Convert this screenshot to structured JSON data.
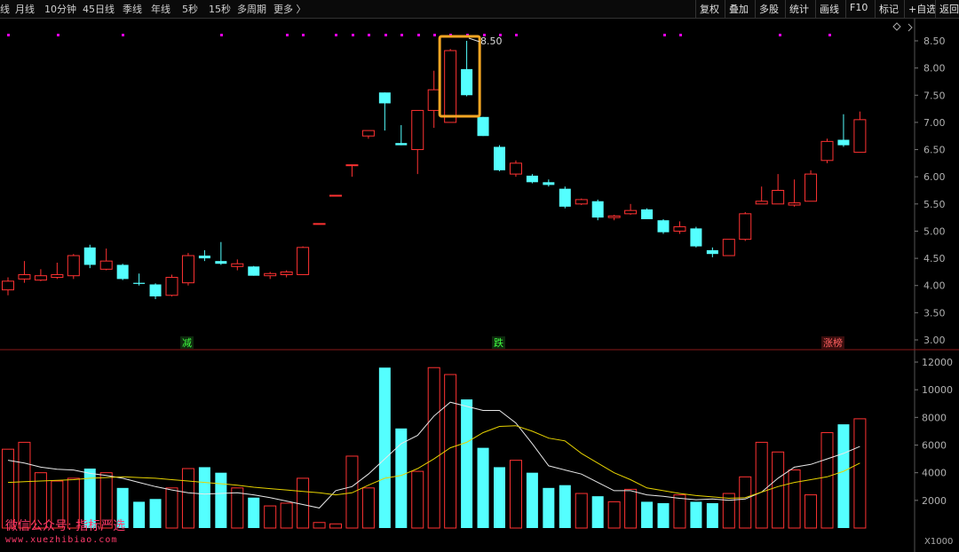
{
  "toolbar": {
    "periods": [
      "线",
      "月线",
      "10分钟",
      "45日线",
      "季线",
      "年线",
      "5秒",
      "15秒",
      "多周期",
      "更多 〉"
    ],
    "actions": [
      "复权",
      "叠加",
      "多股",
      "统计",
      "画线",
      "F10",
      "标记",
      "+自选",
      "返回"
    ]
  },
  "price_axis": {
    "ticks": [
      "8.50",
      "8.00",
      "7.50",
      "7.00",
      "6.50",
      "6.00",
      "5.50",
      "5.00",
      "4.50",
      "4.00",
      "3.50",
      "3.00"
    ]
  },
  "volume_axis": {
    "ticks": [
      "12000",
      "10000",
      "8000",
      "6000",
      "4000",
      "2000"
    ],
    "unit": "X1000"
  },
  "annotations": {
    "high_label": "8.50",
    "labels": [
      "减",
      "跌",
      "涨榜"
    ]
  },
  "watermark": {
    "line1": "微信公众号: 指标严选",
    "line2": "www.xuezhibiao.com"
  },
  "colors": {
    "up": "#ff3232",
    "down": "#54ffff",
    "ma_fast": "#e8e8e8",
    "ma_slow": "#e6d200",
    "highlight": "#f5a623",
    "marker": "#e600e6"
  },
  "chart_data": {
    "type": "candlestick",
    "candles": [
      {
        "o": 3.92,
        "h": 4.15,
        "l": 3.82,
        "c": 4.08,
        "v": 5700,
        "up": true
      },
      {
        "o": 4.12,
        "h": 4.45,
        "l": 4.05,
        "c": 4.2,
        "v": 6200,
        "up": true
      },
      {
        "o": 4.1,
        "h": 4.3,
        "l": 4.08,
        "c": 4.18,
        "v": 4000,
        "up": true
      },
      {
        "o": 4.15,
        "h": 4.42,
        "l": 4.12,
        "c": 4.2,
        "v": 3400,
        "up": true
      },
      {
        "o": 4.18,
        "h": 4.58,
        "l": 4.12,
        "c": 4.55,
        "v": 3600,
        "up": true
      },
      {
        "o": 4.7,
        "h": 4.75,
        "l": 4.32,
        "c": 4.38,
        "v": 4300,
        "up": false
      },
      {
        "o": 4.3,
        "h": 4.68,
        "l": 4.28,
        "c": 4.45,
        "v": 4000,
        "up": true
      },
      {
        "o": 4.38,
        "h": 4.4,
        "l": 4.1,
        "c": 4.12,
        "v": 2900,
        "up": false
      },
      {
        "o": 4.05,
        "h": 4.22,
        "l": 4.0,
        "c": 4.03,
        "v": 1900,
        "up": false
      },
      {
        "o": 4.02,
        "h": 4.04,
        "l": 3.75,
        "c": 3.8,
        "v": 2100,
        "up": false
      },
      {
        "o": 3.82,
        "h": 4.2,
        "l": 3.8,
        "c": 4.15,
        "v": 2900,
        "up": true
      },
      {
        "o": 4.05,
        "h": 4.6,
        "l": 4.0,
        "c": 4.55,
        "v": 4300,
        "up": true
      },
      {
        "o": 4.55,
        "h": 4.65,
        "l": 4.45,
        "c": 4.5,
        "v": 4400,
        "up": false
      },
      {
        "o": 4.45,
        "h": 4.8,
        "l": 4.38,
        "c": 4.4,
        "v": 4000,
        "up": false
      },
      {
        "o": 4.4,
        "h": 4.48,
        "l": 4.28,
        "c": 4.35,
        "v": 2900,
        "up": true
      },
      {
        "o": 4.35,
        "h": 4.36,
        "l": 4.18,
        "c": 4.18,
        "v": 2200,
        "up": false
      },
      {
        "o": 4.18,
        "h": 4.25,
        "l": 4.12,
        "c": 4.22,
        "v": 1600,
        "up": true
      },
      {
        "o": 4.2,
        "h": 4.28,
        "l": 4.15,
        "c": 4.25,
        "v": 1800,
        "up": true
      },
      {
        "o": 4.2,
        "h": 4.72,
        "l": 4.2,
        "c": 4.7,
        "v": 3600,
        "up": true
      },
      {
        "o": 5.14,
        "h": 5.14,
        "l": 5.14,
        "c": 5.14,
        "v": 400,
        "up": true
      },
      {
        "o": 5.66,
        "h": 5.66,
        "l": 5.66,
        "c": 5.66,
        "v": 300,
        "up": true
      },
      {
        "o": 6.22,
        "h": 6.22,
        "l": 6.0,
        "c": 6.22,
        "v": 5200,
        "up": true
      },
      {
        "o": 6.75,
        "h": 6.85,
        "l": 6.7,
        "c": 6.85,
        "v": 2900,
        "up": true
      },
      {
        "o": 7.55,
        "h": 7.55,
        "l": 6.85,
        "c": 7.35,
        "v": 11600,
        "up": false
      },
      {
        "o": 6.62,
        "h": 6.95,
        "l": 6.58,
        "c": 6.58,
        "v": 7200,
        "up": false
      },
      {
        "o": 6.5,
        "h": 7.22,
        "l": 6.05,
        "c": 7.22,
        "v": 4100,
        "up": true
      },
      {
        "o": 7.22,
        "h": 7.95,
        "l": 6.9,
        "c": 7.6,
        "v": 11600,
        "up": true
      },
      {
        "o": 7.0,
        "h": 8.35,
        "l": 7.0,
        "c": 8.32,
        "v": 11100,
        "up": true
      },
      {
        "o": 7.98,
        "h": 8.5,
        "l": 7.48,
        "c": 7.5,
        "v": 9300,
        "up": false
      },
      {
        "o": 7.1,
        "h": 7.1,
        "l": 6.75,
        "c": 6.75,
        "v": 5800,
        "up": false
      },
      {
        "o": 6.55,
        "h": 6.58,
        "l": 6.1,
        "c": 6.12,
        "v": 4400,
        "up": false
      },
      {
        "o": 6.05,
        "h": 6.3,
        "l": 6.0,
        "c": 6.25,
        "v": 4900,
        "up": true
      },
      {
        "o": 6.02,
        "h": 6.05,
        "l": 5.88,
        "c": 5.9,
        "v": 4000,
        "up": false
      },
      {
        "o": 5.9,
        "h": 5.95,
        "l": 5.82,
        "c": 5.85,
        "v": 2900,
        "up": false
      },
      {
        "o": 5.78,
        "h": 5.82,
        "l": 5.42,
        "c": 5.45,
        "v": 3100,
        "up": false
      },
      {
        "o": 5.5,
        "h": 5.6,
        "l": 5.48,
        "c": 5.58,
        "v": 2500,
        "up": true
      },
      {
        "o": 5.55,
        "h": 5.58,
        "l": 5.2,
        "c": 5.25,
        "v": 2300,
        "up": false
      },
      {
        "o": 5.25,
        "h": 5.3,
        "l": 5.2,
        "c": 5.28,
        "v": 1900,
        "up": true
      },
      {
        "o": 5.32,
        "h": 5.5,
        "l": 5.3,
        "c": 5.38,
        "v": 2800,
        "up": true
      },
      {
        "o": 5.4,
        "h": 5.42,
        "l": 5.22,
        "c": 5.22,
        "v": 1900,
        "up": false
      },
      {
        "o": 5.2,
        "h": 5.22,
        "l": 4.95,
        "c": 4.98,
        "v": 1800,
        "up": false
      },
      {
        "o": 5.0,
        "h": 5.18,
        "l": 4.95,
        "c": 5.08,
        "v": 2400,
        "up": true
      },
      {
        "o": 5.05,
        "h": 5.08,
        "l": 4.7,
        "c": 4.72,
        "v": 1900,
        "up": false
      },
      {
        "o": 4.65,
        "h": 4.7,
        "l": 4.52,
        "c": 4.58,
        "v": 1800,
        "up": false
      },
      {
        "o": 4.55,
        "h": 4.85,
        "l": 4.55,
        "c": 4.85,
        "v": 2500,
        "up": true
      },
      {
        "o": 4.85,
        "h": 5.35,
        "l": 4.82,
        "c": 5.32,
        "v": 3700,
        "up": true
      },
      {
        "o": 5.5,
        "h": 5.82,
        "l": 5.5,
        "c": 5.55,
        "v": 6200,
        "up": true
      },
      {
        "o": 5.5,
        "h": 6.05,
        "l": 5.5,
        "c": 5.75,
        "v": 5500,
        "up": true
      },
      {
        "o": 5.48,
        "h": 5.95,
        "l": 5.45,
        "c": 5.52,
        "v": 4200,
        "up": true
      },
      {
        "o": 5.55,
        "h": 6.12,
        "l": 5.55,
        "c": 6.05,
        "v": 2400,
        "up": true
      },
      {
        "o": 6.3,
        "h": 6.7,
        "l": 6.25,
        "c": 6.65,
        "v": 6900,
        "up": true
      },
      {
        "o": 6.68,
        "h": 7.15,
        "l": 6.55,
        "c": 6.58,
        "v": 7500,
        "up": false
      },
      {
        "o": 6.45,
        "h": 7.2,
        "l": 6.45,
        "c": 7.05,
        "v": 7900,
        "up": true
      }
    ],
    "ma_fast": [
      4900,
      4700,
      4400,
      4250,
      4200,
      3950,
      3800,
      3600,
      3300,
      3000,
      2750,
      2550,
      2450,
      2500,
      2550,
      2400,
      2200,
      1950,
      1700,
      1450,
      2700,
      3000,
      3900,
      5000,
      6100,
      6700,
      8100,
      9100,
      8800,
      8500,
      8500,
      7600,
      6100,
      4500,
      4200,
      3900,
      3300,
      2700,
      2700,
      2400,
      2300,
      2150,
      2050,
      2100,
      2000,
      2100,
      2600,
      3600,
      4400,
      4600,
      5000,
      5400,
      5900
    ],
    "ma_slow": [
      3300,
      3350,
      3400,
      3450,
      3500,
      3600,
      3650,
      3700,
      3650,
      3600,
      3500,
      3400,
      3300,
      3200,
      3100,
      2950,
      2850,
      2750,
      2650,
      2550,
      2400,
      2550,
      3100,
      3600,
      3800,
      4300,
      5000,
      5800,
      6200,
      6900,
      7350,
      7400,
      7000,
      6500,
      6300,
      5400,
      4700,
      4000,
      3500,
      2900,
      2700,
      2500,
      2350,
      2250,
      2150,
      2200,
      2600,
      3000,
      3300,
      3500,
      3700,
      4100,
      4700
    ]
  }
}
